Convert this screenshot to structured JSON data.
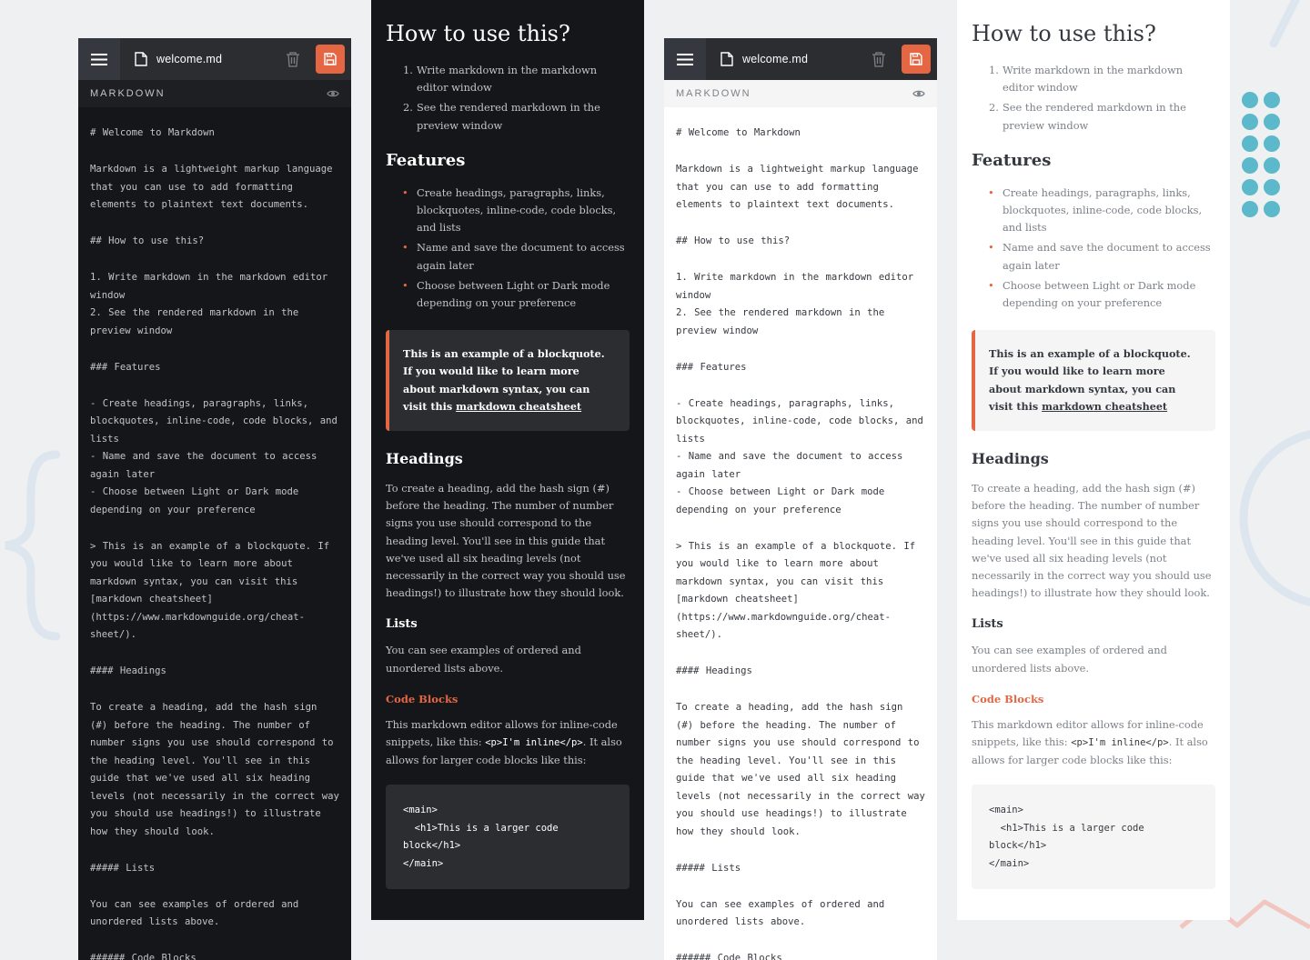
{
  "app": {
    "document_name": "welcome.md",
    "markdown_label": "MARKDOWN"
  },
  "editor_lines": [
    "# Welcome to Markdown",
    "",
    "Markdown is a lightweight markup language that you can use to add formatting elements to plaintext text documents.",
    "",
    "## How to use this?",
    "",
    "1. Write markdown in the markdown editor window",
    "2. See the rendered markdown in the preview window",
    "",
    "### Features",
    "",
    "- Create headings, paragraphs, links, blockquotes, inline-code, code blocks, and lists",
    "- Name and save the document to access again later",
    "- Choose between Light or Dark mode depending on your preference",
    "",
    "> This is an example of a blockquote. If you would like to learn more about markdown syntax, you can visit this [markdown cheatsheet](https://www.markdownguide.org/cheat-sheet/).",
    "",
    "#### Headings",
    "",
    "To create a heading, add the hash sign (#) before the heading. The number of number signs you use should correspond to the heading level. You'll see in this guide that we've used all six heading levels (not necessarily in the correct way you should use headings!) to illustrate how they should look.",
    "",
    "##### Lists",
    "",
    "You can see examples of ordered and unordered lists above.",
    "",
    "###### Code Blocks"
  ],
  "preview": {
    "h2": "How to use this?",
    "ordered_list": [
      "Write markdown in the markdown editor window",
      "See the rendered markdown in the preview window"
    ],
    "features_heading": "Features",
    "unordered_list": [
      "Create headings, paragraphs, links, blockquotes, inline-code, code blocks, and lists",
      "Name and save the document to access again later",
      "Choose between Light or Dark mode depending on your preference"
    ],
    "blockquote_text": "This is an example of a blockquote. If you would like to learn more about markdown syntax, you can visit this ",
    "blockquote_link": "markdown cheatsheet",
    "headings_heading": "Headings",
    "headings_paragraph": "To create a heading, add the hash sign (#) before the heading. The number of number signs you use should correspond to the heading level. You'll see in this guide that we've used all six heading levels (not necessarily in the correct way you should use headings!) to illustrate how they should look.",
    "lists_heading": "Lists",
    "lists_paragraph": "You can see examples of ordered and unordered lists above.",
    "codeblocks_heading": "Code Blocks",
    "code_para_before": "This markdown editor allows for inline-code snippets, like this: ",
    "code_inline": "<p>I'm inline</p>",
    "code_para_after": ". It also allows for larger code blocks like this:",
    "code_block": "<main>\n  <h1>This is a larger code block</h1>\n</main>"
  },
  "colors": {
    "accent": "#e46643",
    "dark_bg": "#151619",
    "dark_bar": "#2b2d31",
    "page_bg": "#eff0f1",
    "dots": "#5bb9cb"
  }
}
